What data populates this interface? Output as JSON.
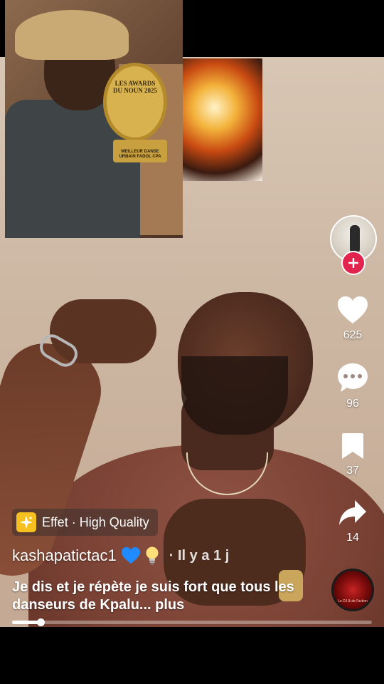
{
  "pip": {
    "trophy_text": "LES AWARDS DU NOUN 2025",
    "trophy_plate": "MEILLEUR DANSE URBAIN FADOL CPA"
  },
  "sidebar": {
    "likes": "625",
    "comments": "96",
    "bookmarks": "37",
    "shares": "14"
  },
  "effect": {
    "label": "Effet · High Quality"
  },
  "author": {
    "username": "kashapatictac1",
    "time_ago": "· Il y a 1 j"
  },
  "caption": "Je dis et je répète je suis fort que tous les danseurs de Kpalu... plus",
  "music": {
    "disc_text": "Le DJ & de l'action"
  },
  "playback": {
    "progress": 0.08
  },
  "colors": {
    "follow": "#e2234d",
    "effect_icon": "#f6c11f"
  }
}
